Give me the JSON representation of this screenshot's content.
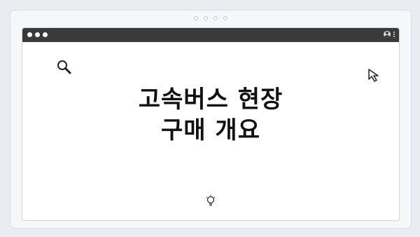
{
  "headline": {
    "line1": "고속버스 현장",
    "line2": "구매 개요"
  },
  "icons": {
    "search": "search-icon",
    "cursor": "cursor-icon",
    "bulb": "lightbulb-icon",
    "user": "user-icon",
    "menu": "kebab-menu-icon"
  },
  "colors": {
    "titlebar": "#3a3a3a",
    "page_background": "#e9edf2",
    "headline_text": "#111111"
  }
}
